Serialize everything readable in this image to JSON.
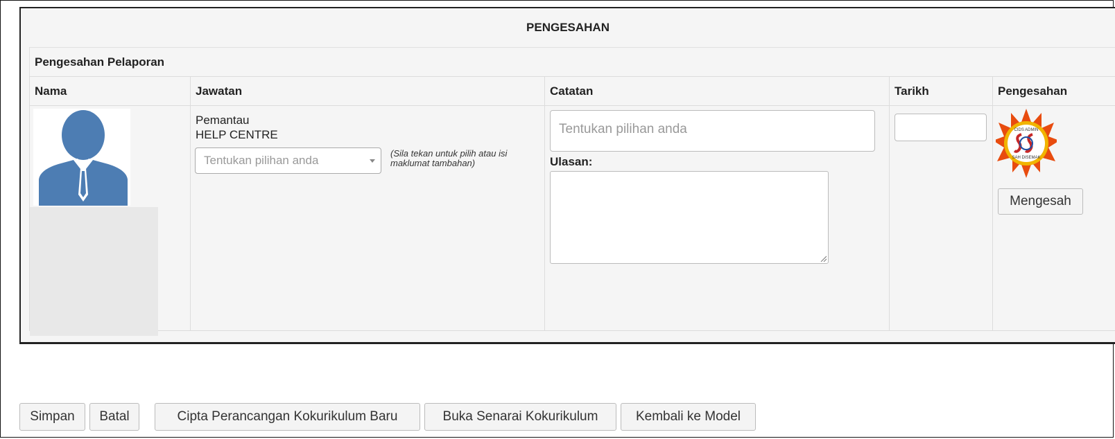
{
  "panel": {
    "title": "PENGESAHAN",
    "section_title": "Pengesahan Pelaporan"
  },
  "table": {
    "headers": [
      "Nama",
      "Jawatan",
      "Catatan",
      "Tarikh",
      "Pengesahan"
    ],
    "row": {
      "jawatan_line1": "Pemantau",
      "jawatan_line2": "HELP CENTRE",
      "select_placeholder": "Tentukan pilihan anda",
      "hint": "(Sila tekan untuk pilih atau isi maklumat tambahan)",
      "catatan_placeholder": "Tentukan pilihan anda",
      "ulasan_label": "Ulasan:",
      "tarikh_value": "",
      "stamp_text_top": "CIDS ADMIN",
      "stamp_text_bottom": "SAH DISEMAK",
      "mengesah_label": "Mengesah"
    }
  },
  "footer_buttons": {
    "simpan": "Simpan",
    "batal": "Batal",
    "cipta": "Cipta Perancangan Kokurikulum Baru",
    "buka": "Buka Senarai Kokurikulum",
    "kembali": "Kembali ke Model"
  },
  "colors": {
    "avatar": "#4d7db3",
    "stamp_star": "#e84c0f",
    "stamp_ring": "#f1b400"
  },
  "icons": {
    "avatar": "user-avatar-icon",
    "stamp": "approval-stamp-icon",
    "dropdown": "chevron-down-icon"
  }
}
